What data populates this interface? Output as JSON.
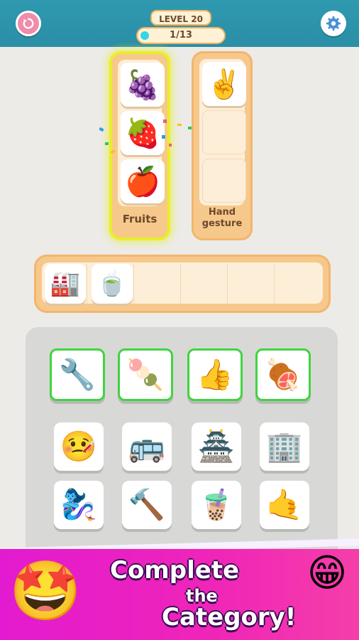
{
  "header": {
    "level_label": "LEVEL 20",
    "progress_text": "1/13",
    "progress_fraction": 0.077,
    "restart_icon": "restart-icon",
    "settings_icon": "gear-icon"
  },
  "categories": [
    {
      "label": "Fruits",
      "items": [
        "🍇",
        "🍓",
        "🍎"
      ],
      "highlight_color": "#e9ee2a"
    },
    {
      "label_line1": "Hand",
      "label_line2": "gesture",
      "items": [
        "✌️"
      ]
    }
  ],
  "tray": {
    "items": [
      "🏭",
      "🍵"
    ],
    "capacity": 6
  },
  "board": {
    "selected_row": [
      "🔧",
      "🍡",
      "👍",
      "🍖"
    ],
    "row2": [
      "🤒",
      "🚌",
      "🏯",
      "🏢"
    ],
    "row3": [
      "🧞‍♀️",
      "🔨",
      "🧋",
      "🤙"
    ],
    "selected_border_color": "#3fd53f"
  },
  "promo": {
    "line1": "Complete",
    "line2": "the",
    "line3": "Category!",
    "left_emoji": "🤩",
    "right_emoji": "😁"
  }
}
